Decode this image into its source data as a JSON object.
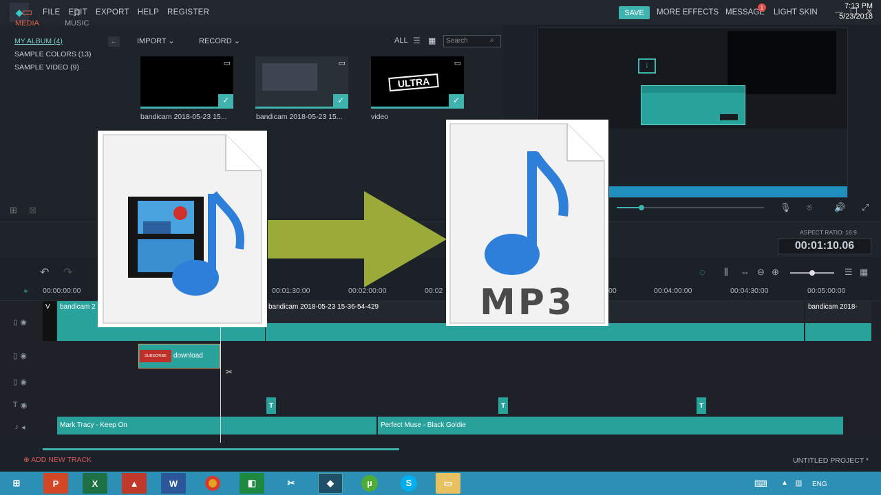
{
  "topbar": {
    "menu": [
      "FILE",
      "EDIT",
      "EXPORT",
      "HELP",
      "REGISTER"
    ],
    "save": "SAVE",
    "more_effects": "MORE EFFECTS",
    "message": "MESSAGE",
    "message_count": "1",
    "light_skin": "LIGHT SKIN"
  },
  "library": {
    "items": [
      "MY ALBUM (4)",
      "SAMPLE COLORS (13)",
      "SAMPLE VIDEO (9)"
    ],
    "import": "IMPORT",
    "record": "RECORD",
    "all": "ALL",
    "search_placeholder": "Search",
    "thumbs": [
      {
        "label": "bandicam 2018-05-23 15..."
      },
      {
        "label": "bandicam 2018-05-23 15..."
      },
      {
        "label": "video"
      }
    ],
    "thumb3_text": "ULTRA"
  },
  "tabs": {
    "media": "MEDIA",
    "music": "MUSIC",
    "aspect_ratio": "ASPECT RATIO: 16:9",
    "timecode": "00:01:10.06"
  },
  "ruler": {
    "ticks": [
      "00:00:00:00",
      "00:01:30:00",
      "00:02:00:00",
      "00:02",
      "00",
      "00:04:00:00",
      "00:04:30:00",
      "00:05:00:00"
    ]
  },
  "tracks": {
    "video_clip_1": "bandicam 2",
    "video_clip_v": "V",
    "video_clip_2": "bandicam 2018-05-23 15-36-54-429",
    "video_clip_3": "bandicam 2018-",
    "overlay_clip": "download",
    "subscribe": "SUBSCRIBE",
    "title_marker": "T",
    "audio_clip_1": "Mark Tracy - Keep On",
    "audio_clip_2": "Perfect Muse - Black Goldie"
  },
  "footer": {
    "add_new_track": "ADD NEW TRACK",
    "project": "UNTITLED PROJECT *"
  },
  "overlay": {
    "mp3_text": "MP3"
  },
  "taskbar": {
    "lang": "ENG",
    "time": "7:13 PM",
    "date": "5/23/2018"
  },
  "colors": {
    "accent": "#3fb3ad",
    "clip": "#2aa29c",
    "arrow": "#9aab3a",
    "taskbar": "#2b8fb6"
  }
}
